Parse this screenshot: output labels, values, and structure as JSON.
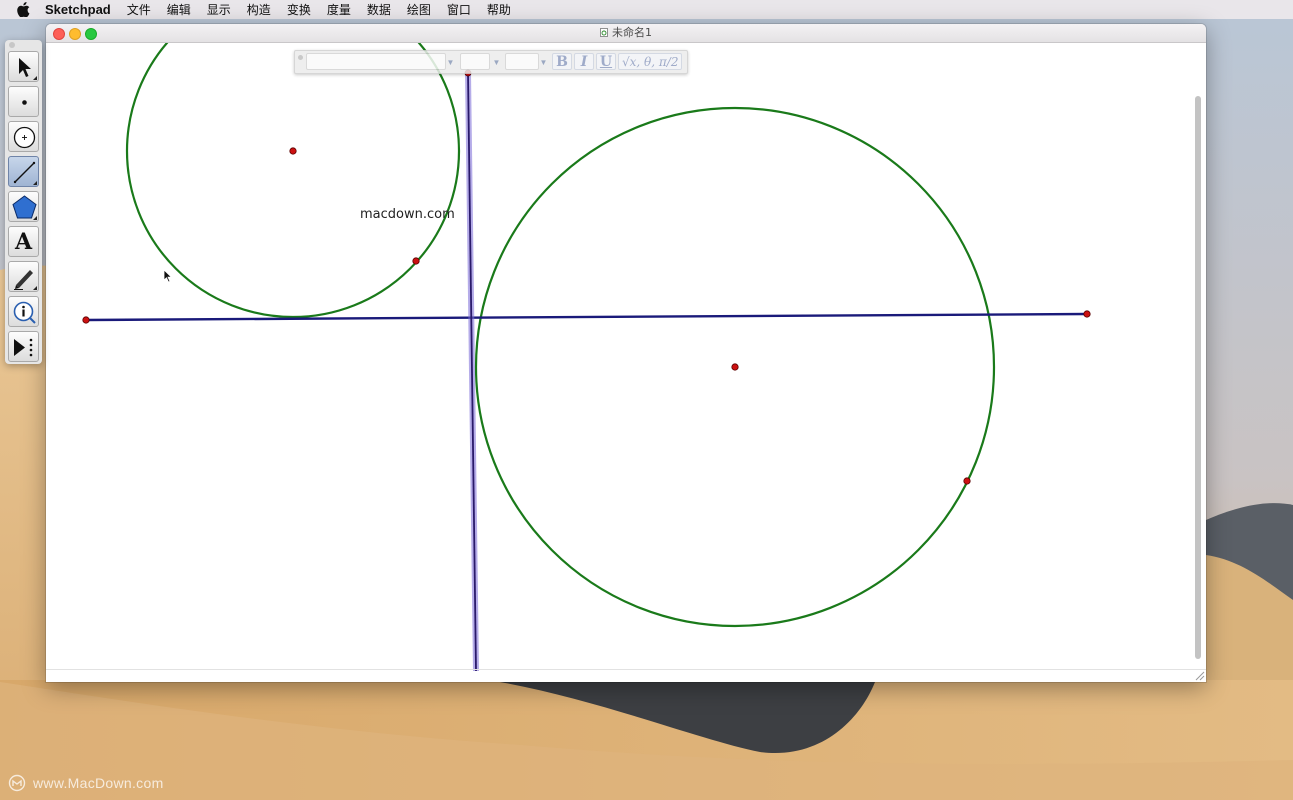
{
  "menubar": {
    "app_name": "Sketchpad",
    "items": [
      "文件",
      "编辑",
      "显示",
      "构造",
      "变换",
      "度量",
      "数据",
      "绘图",
      "窗口",
      "帮助"
    ]
  },
  "window": {
    "title": "未命名1"
  },
  "canvas": {
    "text_label": "macdown.com",
    "colors": {
      "circle": "#1a7a1a",
      "segment": "#1a1a7a",
      "perpendicular": "#4b1ea8",
      "point": "#cc1111"
    }
  },
  "text_toolbar": {
    "font_name": "",
    "font_size": "",
    "color_value": "",
    "bold_label": "B",
    "italic_label": "I",
    "underline_label": "U",
    "math_label": "√x, θ, π/2 ..."
  },
  "tools": [
    {
      "name": "selection-arrow",
      "icon": "arrow-icon",
      "active": false
    },
    {
      "name": "point",
      "icon": "point-icon",
      "active": false
    },
    {
      "name": "compass",
      "icon": "compass-icon",
      "active": false
    },
    {
      "name": "straightedge",
      "icon": "segment-icon",
      "active": true
    },
    {
      "name": "polygon",
      "icon": "polygon-icon",
      "active": false
    },
    {
      "name": "text",
      "icon": "text-a-icon",
      "active": false
    },
    {
      "name": "marker",
      "icon": "pen-icon",
      "active": false
    },
    {
      "name": "information",
      "icon": "info-icon",
      "active": false
    },
    {
      "name": "custom",
      "icon": "custom-tool-icon",
      "active": false
    }
  ],
  "tool_labels": {
    "text": "A"
  },
  "watermark": {
    "text": "www.MacDown.com"
  }
}
